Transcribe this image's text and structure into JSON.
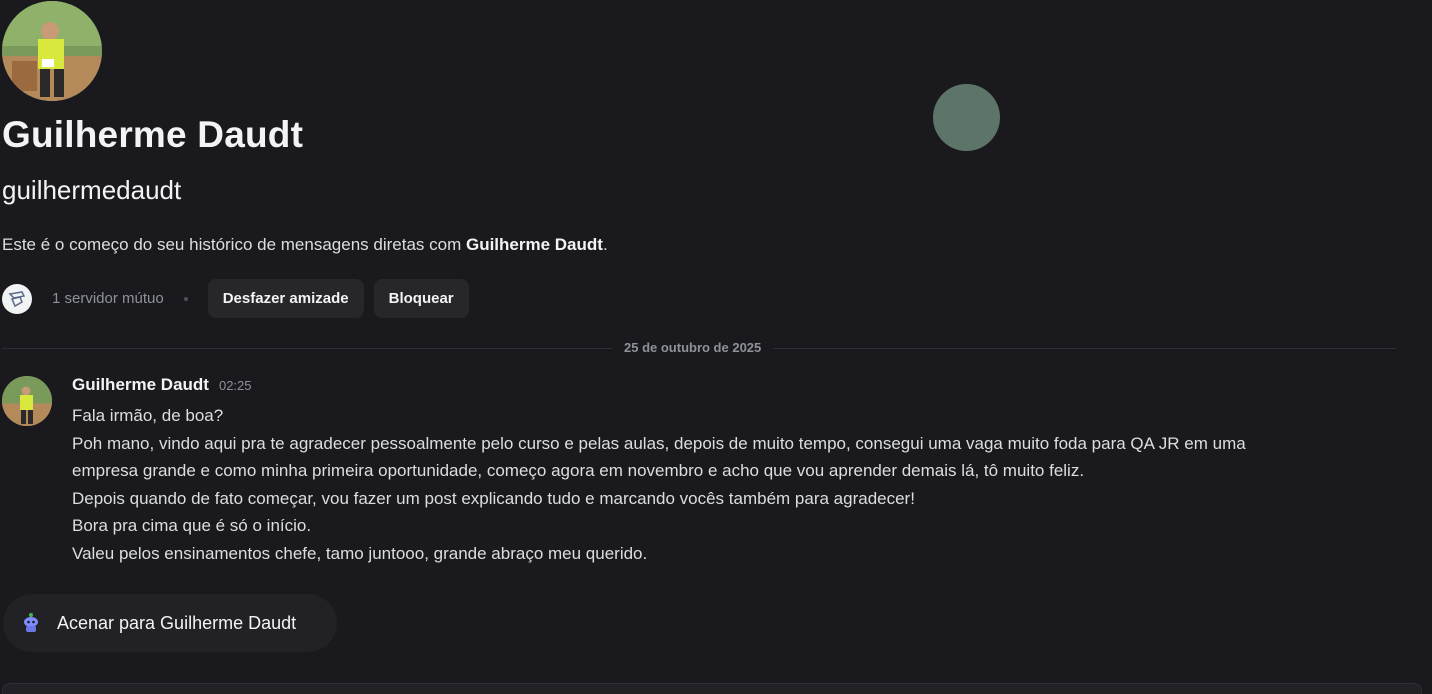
{
  "profile": {
    "display_name": "Guilherme Daudt",
    "username": "guilhermedaudt",
    "intro_prefix": "Este é o começo do seu histórico de mensagens diretas com ",
    "intro_name": "Guilherme Daudt",
    "intro_suffix": "."
  },
  "mutual": {
    "servers_label": "1 servidor mútuo",
    "unfriend_label": "Desfazer amizade",
    "block_label": "Bloquear"
  },
  "divider": {
    "date": "25 de outubro de 2025"
  },
  "message": {
    "author": "Guilherme Daudt",
    "time": "02:25",
    "lines": [
      "Fala irmão, de boa?",
      "Poh mano, vindo aqui pra te agradecer pessoalmente pelo curso e pelas aulas, depois de muito tempo, consegui uma vaga muito foda para QA JR em uma",
      "empresa grande e como minha primeira oportunidade, começo agora em novembro e acho que vou aprender demais lá, tô muito feliz.",
      "Depois quando de fato começar, vou fazer um post explicando tudo e marcando vocês também para agradecer!",
      "Bora pra cima que é só o início.",
      "Valeu pelos ensinamentos chefe, tamo juntooo, grande abraço meu querido."
    ]
  },
  "wave": {
    "label": "Acenar para Guilherme Daudt"
  },
  "colors": {
    "background": "#1a1a1e",
    "button_bg": "#26262b",
    "muted_text": "#8e9297",
    "wave_icon": "#7f8cff"
  }
}
